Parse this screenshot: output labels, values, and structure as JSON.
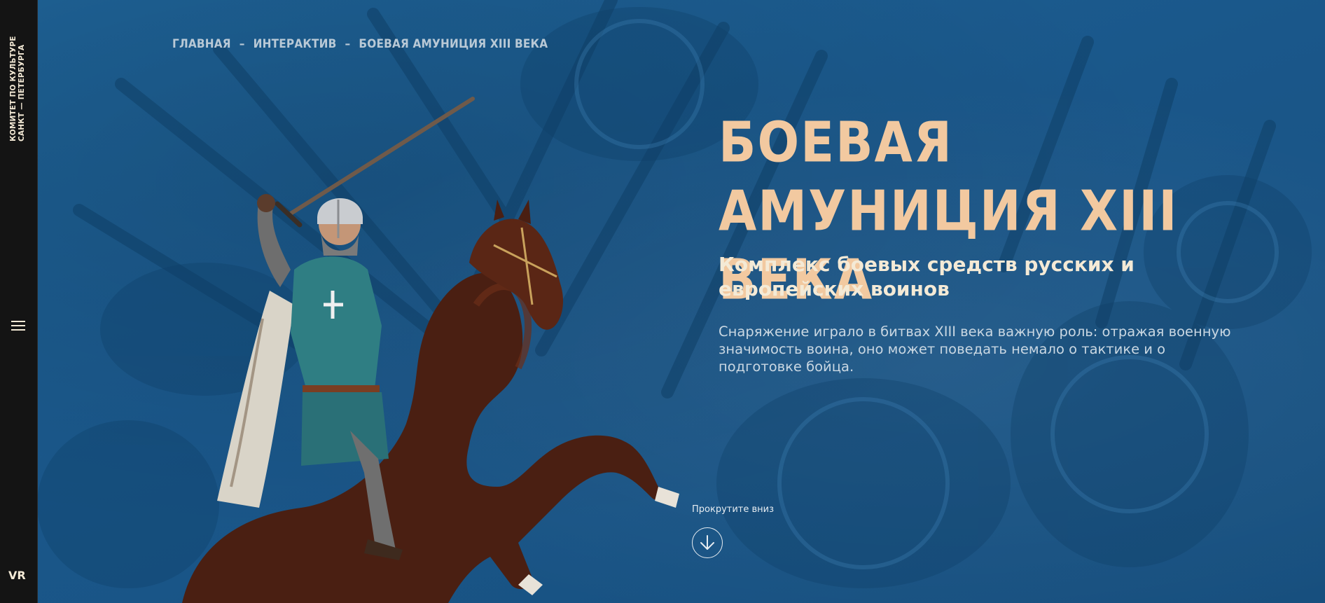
{
  "sidebar": {
    "logo_line1": "КОМИТЕТ ПО КУЛЬТУРЕ",
    "logo_line2": "САНКТ — ПЕТЕРБУРГА",
    "menu_icon": "hamburger-menu-icon",
    "vr_label": "VR"
  },
  "breadcrumb": {
    "items": [
      "ГЛАВНАЯ",
      "ИНТЕРАКТИВ",
      "БОЕВАЯ АМУНИЦИЯ XIII ВЕКА"
    ],
    "separator": "–"
  },
  "hero": {
    "title": "БОЕВАЯ АМУНИЦИЯ XIII ВЕКА",
    "subtitle": "Комплекс боевых средств русских и европейских воинов",
    "description": "Снаряжение играло в битвах XIII века важную роль: отражая военную значимость воина, оно может поведать немало о тактике и о подготовке бойца.",
    "scroll_label": "Прокрутите вниз",
    "scroll_icon": "arrow-down-icon"
  },
  "colors": {
    "background": "#1b5a8b",
    "sidebar": "#141414",
    "title": "#f2c9a0",
    "text": "#f4ead6"
  }
}
